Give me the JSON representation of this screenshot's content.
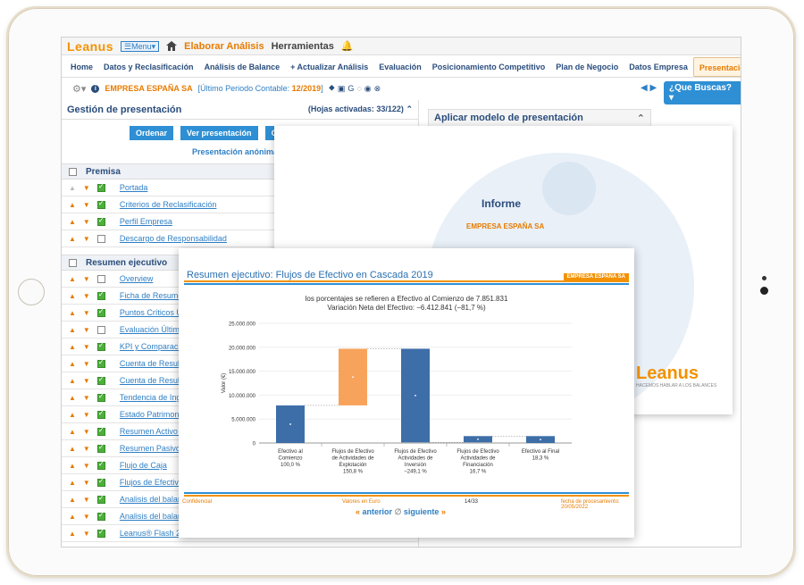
{
  "topbar": {
    "logo": "Leanus",
    "menu_label": "☰Menu▾",
    "elaborar": "Elaborar Análisis",
    "herramientas": "Herramientas"
  },
  "nav": {
    "items": [
      "Home",
      "Datos y Reclasificación",
      "Análisis de Balance",
      "+ Actualizar Análisis",
      "Evaluación",
      "Posicionamiento Competitivo",
      "Plan de Negocio",
      "Datos Empresa",
      "Presentación"
    ]
  },
  "companybar": {
    "company": "EMPRESA ESPAÑA SA",
    "period_prefix": "[Último Periodo Contable: ",
    "period_value": "12/2019",
    "period_suffix": "]",
    "search_label": "¿Que Buscas? ▾"
  },
  "left": {
    "title": "Gestión de presentación",
    "hojas": "(Hojas activadas: 33/122)",
    "buttons": [
      "Ordenar",
      "Ver presentación",
      "Guarda"
    ],
    "anon": "Presentación anónima",
    "section1": "Premisa",
    "rows1": [
      "Portada",
      "Criterios de Reclasificación",
      "Perfil Empresa",
      "Descargo de Responsabilidad"
    ],
    "section2": "Resumen ejecutivo",
    "rows2": [
      "Overview",
      "Ficha de Resumen",
      "Puntos Críticos Últ",
      "Evaluación Último",
      "KPI y Comparació",
      "Cuenta de Resulta",
      "Cuenta de Resulta",
      "Tendencia de Ingr",
      "Estado Patrimonia",
      "Resumen Activo e",
      "Resumen Pasivos",
      "Flujo de Caja",
      "Flujos de Efectivo",
      "Analisis del balanc",
      "Analisis del balanc",
      "Leanus® Flash 2019"
    ]
  },
  "right": {
    "title": "Aplicar modelo de presentación"
  },
  "informe": {
    "title": "Informe",
    "company": "EMPRESA ESPAÑA SA",
    "logo": "Leanus",
    "tagline": "HACEMOS HABLAR A LOS BALANCES"
  },
  "slide": {
    "title": "Resumen ejecutivo: Flujos de Efectivo en Cascada 2019",
    "tag": "EMPRESA ESPAÑA SA",
    "note1": "los porcentajes se refieren a Efectivo al Comienzo de 7.851.831",
    "note2": "Variación Neta del Efectivo: −6.412.841 (−81,7 %)",
    "footer_left": "Confidencial",
    "footer_mid": "Valores en Euro",
    "footer_page": "14/33",
    "footer_right": "fecha de procesamiento: 20/05/2022",
    "prev": "anterior",
    "next": "siguiente"
  },
  "chart_data": {
    "type": "bar",
    "title": "",
    "ylabel": "Valor (€)",
    "ylim": [
      0,
      25000000
    ],
    "yticks": [
      "0",
      "5.000.000",
      "10.000.000",
      "15.000.000",
      "20.000.000",
      "25.000.000"
    ],
    "categories": [
      [
        "Efectivo al",
        "Comienzo",
        "100,0 %"
      ],
      [
        "Flujos de Efectivo",
        "de Actividades de",
        "Explotación",
        "150,8 %"
      ],
      [
        "Flujos de Efectivo",
        "Actividades de",
        "Inversión",
        "−249,1 %"
      ],
      [
        "Flujos de Efectivo",
        "Actividades de",
        "Financiación",
        "16,7 %"
      ],
      [
        "Efectivo al Final",
        "18,3 %"
      ]
    ],
    "bars": [
      {
        "from": 0,
        "to": 7851831,
        "color": "#3d6ea8"
      },
      {
        "from": 7851831,
        "to": 19690000,
        "color": "#f7a35c"
      },
      {
        "from": 19690000,
        "to": 130000,
        "color": "#3d6ea8"
      },
      {
        "from": 130000,
        "to": 1440000,
        "color": "#3d6ea8"
      },
      {
        "from": 0,
        "to": 1438990,
        "color": "#3d6ea8"
      }
    ]
  }
}
